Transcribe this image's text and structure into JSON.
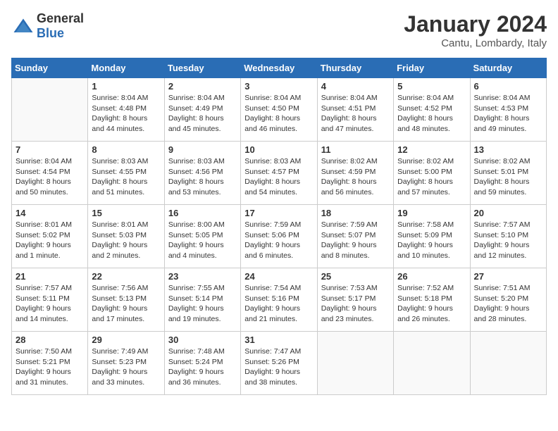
{
  "header": {
    "logo_general": "General",
    "logo_blue": "Blue",
    "month": "January 2024",
    "location": "Cantu, Lombardy, Italy"
  },
  "calendar": {
    "days_of_week": [
      "Sunday",
      "Monday",
      "Tuesday",
      "Wednesday",
      "Thursday",
      "Friday",
      "Saturday"
    ],
    "weeks": [
      [
        {
          "day": "",
          "info": ""
        },
        {
          "day": "1",
          "info": "Sunrise: 8:04 AM\nSunset: 4:48 PM\nDaylight: 8 hours\nand 44 minutes."
        },
        {
          "day": "2",
          "info": "Sunrise: 8:04 AM\nSunset: 4:49 PM\nDaylight: 8 hours\nand 45 minutes."
        },
        {
          "day": "3",
          "info": "Sunrise: 8:04 AM\nSunset: 4:50 PM\nDaylight: 8 hours\nand 46 minutes."
        },
        {
          "day": "4",
          "info": "Sunrise: 8:04 AM\nSunset: 4:51 PM\nDaylight: 8 hours\nand 47 minutes."
        },
        {
          "day": "5",
          "info": "Sunrise: 8:04 AM\nSunset: 4:52 PM\nDaylight: 8 hours\nand 48 minutes."
        },
        {
          "day": "6",
          "info": "Sunrise: 8:04 AM\nSunset: 4:53 PM\nDaylight: 8 hours\nand 49 minutes."
        }
      ],
      [
        {
          "day": "7",
          "info": "Sunrise: 8:04 AM\nSunset: 4:54 PM\nDaylight: 8 hours\nand 50 minutes."
        },
        {
          "day": "8",
          "info": "Sunrise: 8:03 AM\nSunset: 4:55 PM\nDaylight: 8 hours\nand 51 minutes."
        },
        {
          "day": "9",
          "info": "Sunrise: 8:03 AM\nSunset: 4:56 PM\nDaylight: 8 hours\nand 53 minutes."
        },
        {
          "day": "10",
          "info": "Sunrise: 8:03 AM\nSunset: 4:57 PM\nDaylight: 8 hours\nand 54 minutes."
        },
        {
          "day": "11",
          "info": "Sunrise: 8:02 AM\nSunset: 4:59 PM\nDaylight: 8 hours\nand 56 minutes."
        },
        {
          "day": "12",
          "info": "Sunrise: 8:02 AM\nSunset: 5:00 PM\nDaylight: 8 hours\nand 57 minutes."
        },
        {
          "day": "13",
          "info": "Sunrise: 8:02 AM\nSunset: 5:01 PM\nDaylight: 8 hours\nand 59 minutes."
        }
      ],
      [
        {
          "day": "14",
          "info": "Sunrise: 8:01 AM\nSunset: 5:02 PM\nDaylight: 9 hours\nand 1 minute."
        },
        {
          "day": "15",
          "info": "Sunrise: 8:01 AM\nSunset: 5:03 PM\nDaylight: 9 hours\nand 2 minutes."
        },
        {
          "day": "16",
          "info": "Sunrise: 8:00 AM\nSunset: 5:05 PM\nDaylight: 9 hours\nand 4 minutes."
        },
        {
          "day": "17",
          "info": "Sunrise: 7:59 AM\nSunset: 5:06 PM\nDaylight: 9 hours\nand 6 minutes."
        },
        {
          "day": "18",
          "info": "Sunrise: 7:59 AM\nSunset: 5:07 PM\nDaylight: 9 hours\nand 8 minutes."
        },
        {
          "day": "19",
          "info": "Sunrise: 7:58 AM\nSunset: 5:09 PM\nDaylight: 9 hours\nand 10 minutes."
        },
        {
          "day": "20",
          "info": "Sunrise: 7:57 AM\nSunset: 5:10 PM\nDaylight: 9 hours\nand 12 minutes."
        }
      ],
      [
        {
          "day": "21",
          "info": "Sunrise: 7:57 AM\nSunset: 5:11 PM\nDaylight: 9 hours\nand 14 minutes."
        },
        {
          "day": "22",
          "info": "Sunrise: 7:56 AM\nSunset: 5:13 PM\nDaylight: 9 hours\nand 17 minutes."
        },
        {
          "day": "23",
          "info": "Sunrise: 7:55 AM\nSunset: 5:14 PM\nDaylight: 9 hours\nand 19 minutes."
        },
        {
          "day": "24",
          "info": "Sunrise: 7:54 AM\nSunset: 5:16 PM\nDaylight: 9 hours\nand 21 minutes."
        },
        {
          "day": "25",
          "info": "Sunrise: 7:53 AM\nSunset: 5:17 PM\nDaylight: 9 hours\nand 23 minutes."
        },
        {
          "day": "26",
          "info": "Sunrise: 7:52 AM\nSunset: 5:18 PM\nDaylight: 9 hours\nand 26 minutes."
        },
        {
          "day": "27",
          "info": "Sunrise: 7:51 AM\nSunset: 5:20 PM\nDaylight: 9 hours\nand 28 minutes."
        }
      ],
      [
        {
          "day": "28",
          "info": "Sunrise: 7:50 AM\nSunset: 5:21 PM\nDaylight: 9 hours\nand 31 minutes."
        },
        {
          "day": "29",
          "info": "Sunrise: 7:49 AM\nSunset: 5:23 PM\nDaylight: 9 hours\nand 33 minutes."
        },
        {
          "day": "30",
          "info": "Sunrise: 7:48 AM\nSunset: 5:24 PM\nDaylight: 9 hours\nand 36 minutes."
        },
        {
          "day": "31",
          "info": "Sunrise: 7:47 AM\nSunset: 5:26 PM\nDaylight: 9 hours\nand 38 minutes."
        },
        {
          "day": "",
          "info": ""
        },
        {
          "day": "",
          "info": ""
        },
        {
          "day": "",
          "info": ""
        }
      ]
    ]
  }
}
